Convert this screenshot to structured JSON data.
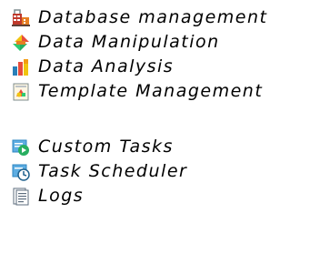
{
  "menu": {
    "group1": [
      {
        "label": "Database management",
        "icon": "database-management-icon"
      },
      {
        "label": "Data Manipulation",
        "icon": "data-manipulation-icon"
      },
      {
        "label": "Data Analysis",
        "icon": "data-analysis-icon"
      },
      {
        "label": "Template Management",
        "icon": "template-management-icon"
      }
    ],
    "group2": [
      {
        "label": "Custom Tasks",
        "icon": "custom-tasks-icon"
      },
      {
        "label": "Task Scheduler",
        "icon": "task-scheduler-icon"
      },
      {
        "label": "Logs",
        "icon": "logs-icon"
      }
    ]
  }
}
